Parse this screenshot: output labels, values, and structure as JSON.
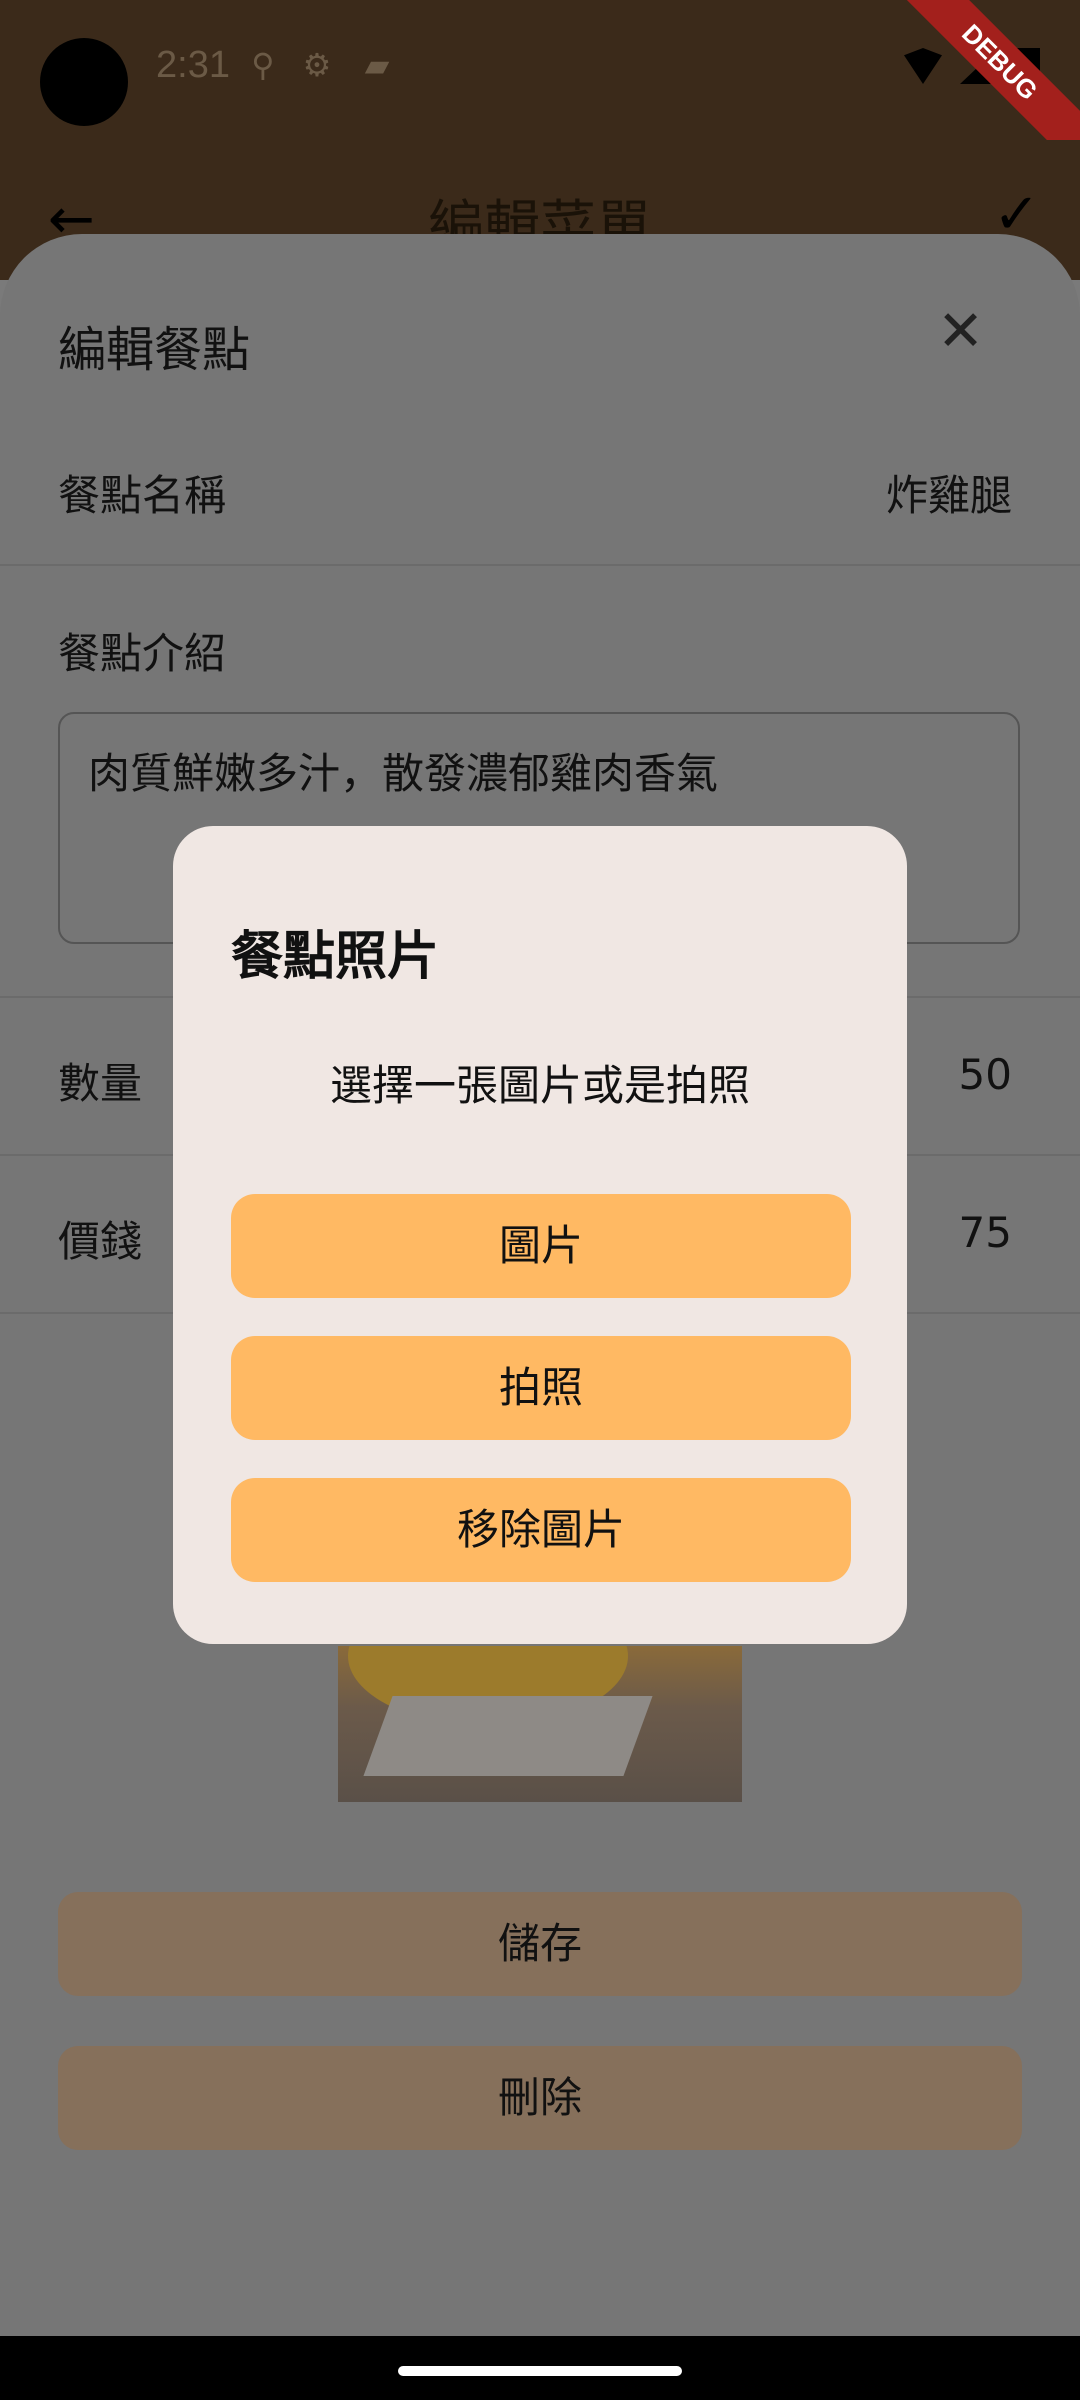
{
  "status_bar": {
    "time": "2:31",
    "left_icons": [
      "sync-icon",
      "settings-icon",
      "sd-card-icon"
    ],
    "right_icons": [
      "wifi-icon",
      "signal-icon",
      "battery-icon"
    ],
    "debug_label": "DEBUG"
  },
  "app_bar": {
    "title": "編輯菜單",
    "back_icon": "←",
    "confirm_icon": "✓"
  },
  "sheet": {
    "title": "編輯餐點",
    "close_icon": "✕",
    "name_label": "餐點名稱",
    "name_value": "炸雞腿",
    "description_label": "餐點介紹",
    "description_value": "肉質鮮嫩多汁，散發濃郁雞肉香氣",
    "quantity_label": "數量",
    "quantity_value": "50",
    "price_label": "價錢",
    "price_value": "75",
    "save_label": "儲存",
    "delete_label": "刪除"
  },
  "dialog": {
    "title": "餐點照片",
    "message": "選擇一張圖片或是拍照",
    "buttons": [
      "圖片",
      "拍照",
      "移除圖片"
    ],
    "button_color": "#ffb963"
  }
}
